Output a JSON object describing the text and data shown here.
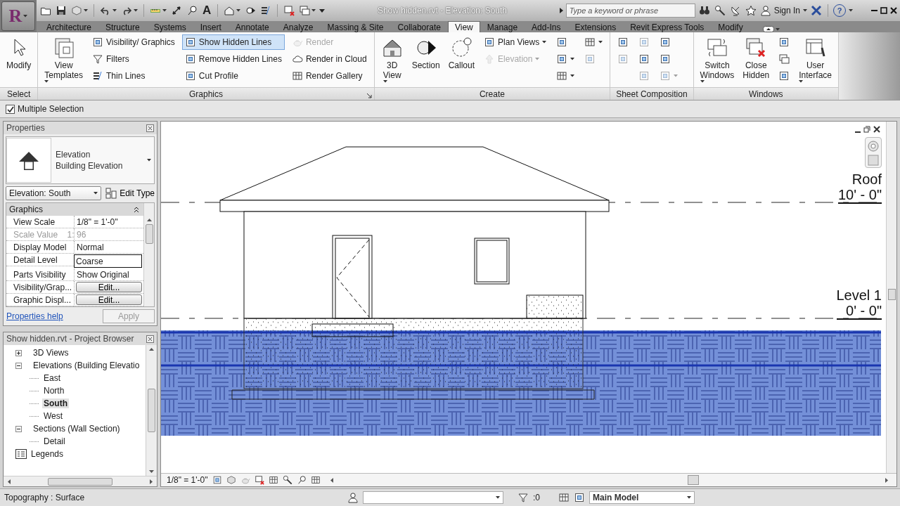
{
  "title_bar": {
    "app_button": "R",
    "text_tool": "A",
    "title": "Show hidden.rvt - Elevation: South",
    "search": {
      "placeholder": "Type a keyword or phrase"
    },
    "sign_in": "Sign In",
    "help": "?"
  },
  "tabs": [
    {
      "label": "Architecture",
      "selected": false
    },
    {
      "label": "Structure",
      "selected": false
    },
    {
      "label": "Systems",
      "selected": false
    },
    {
      "label": "Insert",
      "selected": false
    },
    {
      "label": "Annotate",
      "selected": false
    },
    {
      "label": "Analyze",
      "selected": false
    },
    {
      "label": "Massing & Site",
      "selected": false
    },
    {
      "label": "Collaborate",
      "selected": false
    },
    {
      "label": "View",
      "selected": true
    },
    {
      "label": "Manage",
      "selected": false
    },
    {
      "label": "Add-Ins",
      "selected": false
    },
    {
      "label": "Extensions",
      "selected": false
    },
    {
      "label": "Revit Express Tools",
      "selected": false
    },
    {
      "label": "Modify",
      "selected": false
    }
  ],
  "ribbon": {
    "panels": [
      {
        "title": "Select",
        "launcher": false,
        "columns": [
          {
            "kind": "large",
            "label": "Modify",
            "dropdown": false
          }
        ]
      },
      {
        "title": "Graphics",
        "launcher": true,
        "columns": [
          {
            "kind": "large",
            "label": "View Templates",
            "dropdown": true
          },
          {
            "kind": "stack",
            "items": [
              {
                "label": "Visibility/ Graphics",
                "selected": false,
                "disabled": false,
                "dropdown": false
              },
              {
                "label": "Filters",
                "selected": false,
                "disabled": false,
                "dropdown": false
              },
              {
                "label": "Thin Lines",
                "selected": false,
                "disabled": false,
                "dropdown": false
              }
            ]
          },
          {
            "kind": "stack",
            "items": [
              {
                "label": "Show Hidden Lines",
                "selected": true,
                "disabled": false,
                "dropdown": false
              },
              {
                "label": "Remove Hidden Lines",
                "selected": false,
                "disabled": false,
                "dropdown": false
              },
              {
                "label": "Cut Profile",
                "selected": false,
                "disabled": false,
                "dropdown": false
              }
            ]
          },
          {
            "kind": "stack",
            "items": [
              {
                "label": "Render",
                "selected": false,
                "disabled": true,
                "dropdown": false
              },
              {
                "label": "Render in Cloud",
                "selected": false,
                "disabled": false,
                "dropdown": false
              },
              {
                "label": "Render Gallery",
                "selected": false,
                "disabled": false,
                "dropdown": false
              }
            ]
          }
        ]
      },
      {
        "title": "Create",
        "launcher": false,
        "columns": [
          {
            "kind": "large",
            "label": "3D View",
            "dropdown": true
          },
          {
            "kind": "large",
            "label": "Section",
            "dropdown": false
          },
          {
            "kind": "large",
            "label": "Callout",
            "dropdown": false
          },
          {
            "kind": "stack",
            "items": [
              {
                "label": "Plan Views",
                "selected": false,
                "disabled": false,
                "dropdown": true
              },
              {
                "label": "Elevation",
                "selected": false,
                "disabled": true,
                "dropdown": true
              }
            ]
          },
          {
            "kind": "stack",
            "items": [
              {
                "selected": false,
                "disabled": false,
                "dropdown": false
              },
              {
                "selected": false,
                "disabled": false,
                "dropdown": true
              },
              {
                "selected": false,
                "disabled": false,
                "dropdown": true
              }
            ]
          },
          {
            "kind": "stack",
            "items": [
              {
                "selected": false,
                "disabled": false,
                "dropdown": true
              },
              {
                "selected": false,
                "disabled": true,
                "dropdown": false
              }
            ]
          }
        ]
      },
      {
        "title": "Sheet Composition",
        "launcher": false,
        "columns": [
          {
            "kind": "stack",
            "items": [
              {
                "selected": false,
                "disabled": false,
                "dropdown": false
              },
              {
                "selected": false,
                "disabled": true,
                "dropdown": false
              }
            ]
          },
          {
            "kind": "stack",
            "items": [
              {
                "selected": false,
                "disabled": true,
                "dropdown": false
              },
              {
                "selected": false,
                "disabled": false,
                "dropdown": false
              },
              {
                "selected": false,
                "disabled": true,
                "dropdown": false
              }
            ]
          },
          {
            "kind": "stack",
            "items": [
              {
                "selected": false,
                "disabled": false,
                "dropdown": false
              },
              {
                "selected": false,
                "disabled": false,
                "dropdown": false
              },
              {
                "selected": false,
                "disabled": true,
                "dropdown": true
              }
            ]
          }
        ]
      },
      {
        "title": "Windows",
        "launcher": false,
        "columns": [
          {
            "kind": "large",
            "label": "Switch Windows",
            "dropdown": true
          },
          {
            "kind": "large",
            "label": "Close Hidden",
            "dropdown": false
          },
          {
            "kind": "stack",
            "items": [
              {
                "selected": false,
                "disabled": false,
                "dropdown": false
              },
              {
                "selected": false,
                "disabled": false,
                "dropdown": false
              },
              {
                "selected": false,
                "disabled": false,
                "dropdown": false
              }
            ]
          },
          {
            "kind": "large",
            "label": "User Interface",
            "dropdown": true
          }
        ]
      }
    ]
  },
  "options_bar": {
    "multiple_selection": {
      "label": "Multiple Selection",
      "checked": true
    }
  },
  "properties": {
    "title": "Properties",
    "type": {
      "family": "Elevation",
      "type": "Building Elevation"
    },
    "instance": "Elevation: South",
    "edit_type": "Edit Type",
    "group": "Graphics",
    "rows": [
      {
        "name": "View Scale",
        "value": "1/8\" = 1'-0\"",
        "kind": "text",
        "disabled": false
      },
      {
        "name": "Scale Value    1:",
        "value": "96",
        "kind": "text",
        "disabled": true
      },
      {
        "name": "Display Model",
        "value": "Normal",
        "kind": "text",
        "disabled": false
      },
      {
        "name": "Detail Level",
        "value": "Coarse",
        "kind": "field",
        "disabled": false
      },
      {
        "name": "Parts Visibility",
        "value": "Show Original",
        "kind": "text",
        "disabled": false
      },
      {
        "name": "Visibility/Grap...",
        "value": "Edit...",
        "kind": "button",
        "disabled": false
      },
      {
        "name": "Graphic Displ...",
        "value": "Edit...",
        "kind": "button",
        "disabled": false
      }
    ],
    "help": "Properties help",
    "apply": {
      "label": "Apply",
      "disabled": true
    }
  },
  "project_browser": {
    "title": "Show hidden.rvt - Project Browser",
    "tree": [
      {
        "label": "3D Views",
        "kind": "group",
        "expanded": false,
        "selected": false
      },
      {
        "label": "Elevations (Building Elevatio",
        "kind": "group",
        "expanded": true,
        "selected": false,
        "children": [
          {
            "label": "East",
            "kind": "view",
            "selected": false
          },
          {
            "label": "North",
            "kind": "view",
            "selected": false
          },
          {
            "label": "South",
            "kind": "view",
            "selected": true
          },
          {
            "label": "West",
            "kind": "view",
            "selected": false
          }
        ]
      },
      {
        "label": "Sections (Wall Section)",
        "kind": "group",
        "expanded": true,
        "selected": false,
        "children": [
          {
            "label": "Detail",
            "kind": "view",
            "selected": false
          }
        ]
      },
      {
        "label": "Legends",
        "kind": "legend",
        "selected": false
      }
    ]
  },
  "canvas": {
    "levels": [
      {
        "name": "Roof",
        "elevation": "10' - 0\""
      },
      {
        "name": "Level 1",
        "elevation": "0' - 0\""
      }
    ],
    "scale": "1/8\" = 1'-0\""
  },
  "status_bar": {
    "text": "Topography : Surface",
    "filter": ":0",
    "model": "Main Model"
  }
}
